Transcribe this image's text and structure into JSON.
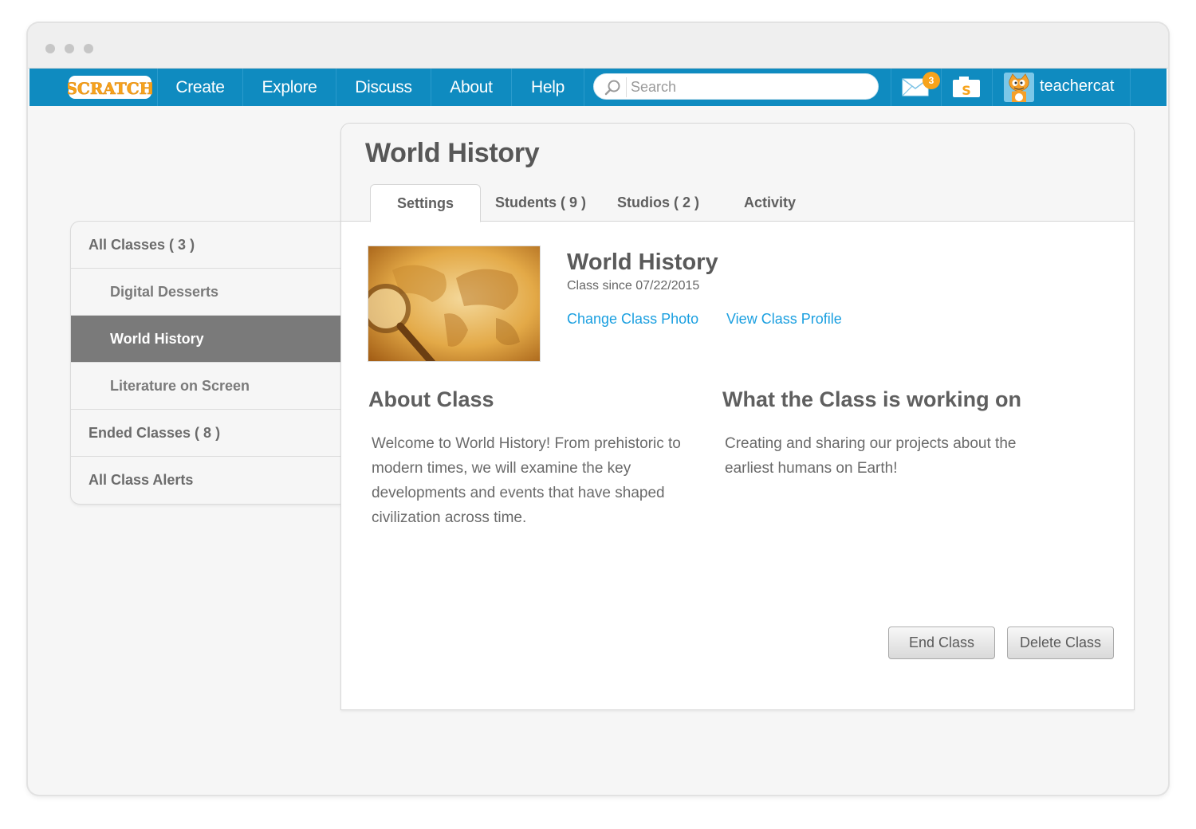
{
  "window": {
    "controls": [
      "close",
      "minimize",
      "maximize"
    ]
  },
  "navbar": {
    "logo_text": "SCRATCH",
    "links": [
      "Create",
      "Explore",
      "Discuss",
      "About",
      "Help"
    ],
    "search": {
      "placeholder": "Search",
      "value": ""
    },
    "messages": {
      "icon": "envelope-icon",
      "count": "3"
    },
    "my_stuff": {
      "icon": "folder-icon"
    },
    "user": {
      "username": "teachercat",
      "avatar": "scratch-cat-avatar"
    },
    "colors": {
      "bar": "#0f8bc0",
      "badge": "#f7a31b"
    }
  },
  "sidebar": {
    "items": [
      {
        "label": "All Classes ( 3 )",
        "level": "top",
        "active": false
      },
      {
        "label": "Digital Desserts",
        "level": "sub",
        "active": false
      },
      {
        "label": "World History",
        "level": "sub",
        "active": true
      },
      {
        "label": "Literature on Screen",
        "level": "sub",
        "active": false
      },
      {
        "label": "Ended Classes ( 8 )",
        "level": "top",
        "active": false
      },
      {
        "label": "All Class Alerts",
        "level": "top",
        "active": false
      }
    ]
  },
  "panel": {
    "title": "World History",
    "tabs": [
      {
        "label": "Settings",
        "active": true
      },
      {
        "label": "Students ( 9 )",
        "active": false
      },
      {
        "label": "Studios ( 2 )",
        "active": false
      },
      {
        "label": "Activity",
        "active": false
      }
    ],
    "class_info": {
      "name": "World History",
      "since": "Class since 07/22/2015",
      "change_photo_link": "Change Class Photo",
      "view_profile_link": "View Class Profile",
      "photo_alt": "old world map with magnifying glass"
    },
    "about": {
      "title": "About Class",
      "text": "Welcome to World History! From prehistoric to modern times, we will examine the key developments and events that have shaped civilization across time."
    },
    "working_on": {
      "title": "What the Class is working on",
      "text": "Creating and sharing our projects about the earliest humans on Earth!"
    },
    "actions": {
      "end_class": "End Class",
      "delete_class": "Delete Class"
    },
    "colors": {
      "link": "#1a9fe0",
      "active_sidebar": "#7a7a7a"
    }
  }
}
